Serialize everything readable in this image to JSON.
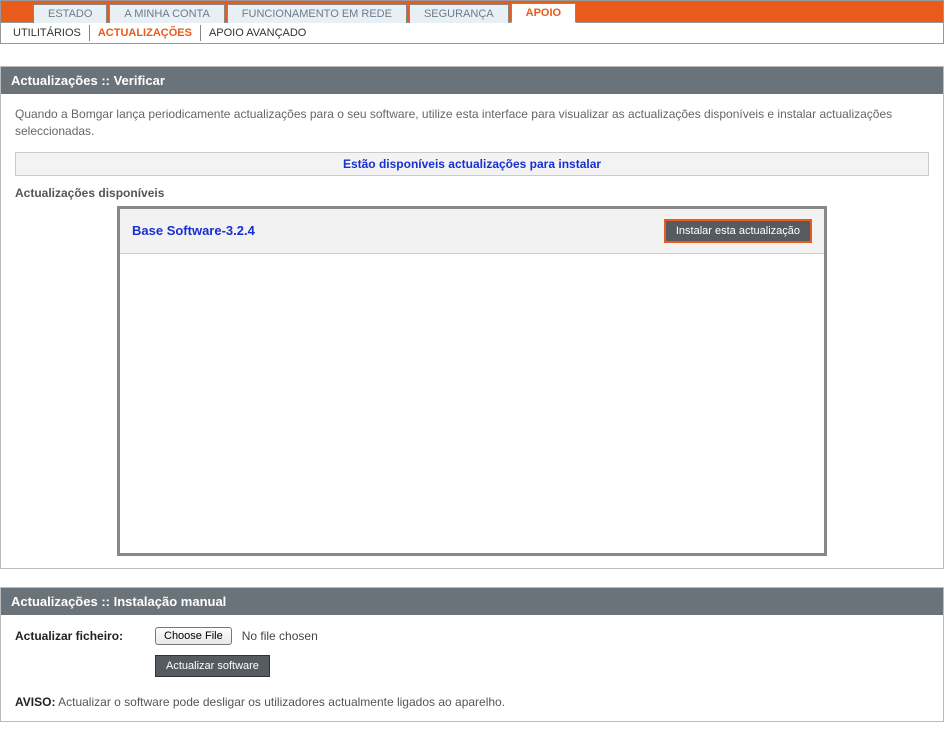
{
  "tabs": {
    "main": [
      {
        "label": "ESTADO"
      },
      {
        "label": "A MINHA CONTA"
      },
      {
        "label": "FUNCIONAMENTO EM REDE"
      },
      {
        "label": "SEGURANÇA"
      },
      {
        "label": "APOIO",
        "active": true
      }
    ],
    "sub": [
      {
        "label": "UTILITÁRIOS"
      },
      {
        "label": "ACTUALIZAÇÕES",
        "active": true
      },
      {
        "label": "APOIO AVANÇADO"
      }
    ]
  },
  "verify": {
    "title": "Actualizações :: Verificar",
    "description": "Quando a Bomgar lança periodicamente actualizações para o seu software, utilize esta interface para visualizar as actualizações disponíveis e instalar actualizações seleccionadas.",
    "notice": "Estão disponíveis actualizações para instalar",
    "available_heading": "Actualizações disponíveis",
    "updates": [
      {
        "name": "Base Software-3.2.4",
        "install_label": "Instalar esta actualização"
      }
    ]
  },
  "manual": {
    "title": "Actualizações :: Instalação manual",
    "file_label": "Actualizar ficheiro:",
    "choose_file_label": "Choose File",
    "no_file_text": "No file chosen",
    "submit_label": "Actualizar software",
    "warning_prefix": "AVISO:",
    "warning_text": " Actualizar o software pode desligar os utilizadores actualmente ligados ao aparelho."
  }
}
